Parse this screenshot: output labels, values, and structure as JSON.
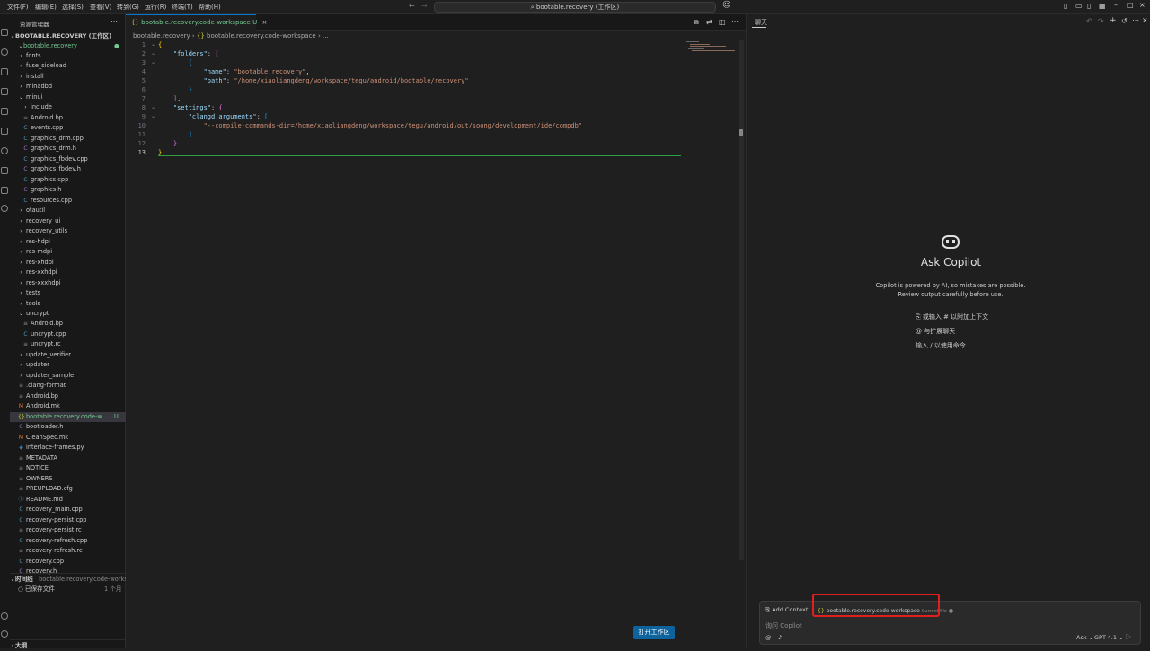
{
  "menu": [
    "文件(F)",
    "编辑(E)",
    "选择(S)",
    "查看(V)",
    "转到(G)",
    "运行(R)",
    "终端(T)",
    "帮助(H)"
  ],
  "search": {
    "text": "bootable.recovery (工作区)"
  },
  "sidebar": {
    "header": "资源管理器",
    "workspace": "BOOTABLE.RECOVERY (工作区)",
    "root": "bootable.recovery",
    "items": [
      {
        "label": "fonts",
        "icon": "folder",
        "indent": 1
      },
      {
        "label": "fuse_sideload",
        "icon": "folder",
        "indent": 1
      },
      {
        "label": "install",
        "icon": "folder",
        "indent": 1
      },
      {
        "label": "minadbd",
        "icon": "folder",
        "indent": 1
      },
      {
        "label": "minui",
        "icon": "folder-open",
        "indent": 1
      },
      {
        "label": "include",
        "icon": "folder",
        "indent": 2
      },
      {
        "label": "Android.bp",
        "icon": "file",
        "indent": 2
      },
      {
        "label": "events.cpp",
        "icon": "cpp",
        "indent": 2
      },
      {
        "label": "graphics_drm.cpp",
        "icon": "cpp",
        "indent": 2
      },
      {
        "label": "graphics_drm.h",
        "icon": "h",
        "indent": 2
      },
      {
        "label": "graphics_fbdev.cpp",
        "icon": "cpp",
        "indent": 2
      },
      {
        "label": "graphics_fbdev.h",
        "icon": "h",
        "indent": 2
      },
      {
        "label": "graphics.cpp",
        "icon": "cpp",
        "indent": 2
      },
      {
        "label": "graphics.h",
        "icon": "h",
        "indent": 2
      },
      {
        "label": "resources.cpp",
        "icon": "cpp",
        "indent": 2
      },
      {
        "label": "otautil",
        "icon": "folder",
        "indent": 1
      },
      {
        "label": "recovery_ui",
        "icon": "folder",
        "indent": 1
      },
      {
        "label": "recovery_utils",
        "icon": "folder",
        "indent": 1
      },
      {
        "label": "res-hdpi",
        "icon": "folder",
        "indent": 1
      },
      {
        "label": "res-mdpi",
        "icon": "folder",
        "indent": 1
      },
      {
        "label": "res-xhdpi",
        "icon": "folder",
        "indent": 1
      },
      {
        "label": "res-xxhdpi",
        "icon": "folder",
        "indent": 1
      },
      {
        "label": "res-xxxhdpi",
        "icon": "folder",
        "indent": 1
      },
      {
        "label": "tests",
        "icon": "folder",
        "indent": 1
      },
      {
        "label": "tools",
        "icon": "folder",
        "indent": 1
      },
      {
        "label": "uncrypt",
        "icon": "folder-open",
        "indent": 1
      },
      {
        "label": "Android.bp",
        "icon": "file",
        "indent": 2
      },
      {
        "label": "uncrypt.cpp",
        "icon": "cpp",
        "indent": 2
      },
      {
        "label": "uncrypt.rc",
        "icon": "file",
        "indent": 2
      },
      {
        "label": "update_verifier",
        "icon": "folder",
        "indent": 1
      },
      {
        "label": "updater",
        "icon": "folder",
        "indent": 1
      },
      {
        "label": "updater_sample",
        "icon": "folder",
        "indent": 1
      },
      {
        "label": ".clang-format",
        "icon": "file",
        "indent": 1
      },
      {
        "label": "Android.bp",
        "icon": "file",
        "indent": 1
      },
      {
        "label": "Android.mk",
        "icon": "mk",
        "indent": 1
      },
      {
        "label": "bootable.recovery.code-w...",
        "icon": "json",
        "indent": 1,
        "selected": true,
        "badge": "U"
      },
      {
        "label": "bootloader.h",
        "icon": "h",
        "indent": 1
      },
      {
        "label": "CleanSpec.mk",
        "icon": "mk",
        "indent": 1
      },
      {
        "label": "interlace-frames.py",
        "icon": "py",
        "indent": 1
      },
      {
        "label": "METADATA",
        "icon": "file",
        "indent": 1
      },
      {
        "label": "NOTICE",
        "icon": "file",
        "indent": 1
      },
      {
        "label": "OWNERS",
        "icon": "file",
        "indent": 1
      },
      {
        "label": "PREUPLOAD.cfg",
        "icon": "file",
        "indent": 1
      },
      {
        "label": "README.md",
        "icon": "info",
        "indent": 1
      },
      {
        "label": "recovery_main.cpp",
        "icon": "cpp",
        "indent": 1
      },
      {
        "label": "recovery-persist.cpp",
        "icon": "cpp",
        "indent": 1
      },
      {
        "label": "recovery-persist.rc",
        "icon": "file",
        "indent": 1
      },
      {
        "label": "recovery-refresh.cpp",
        "icon": "cpp",
        "indent": 1
      },
      {
        "label": "recovery-refresh.rc",
        "icon": "file",
        "indent": 1
      },
      {
        "label": "recovery.cpp",
        "icon": "cpp",
        "indent": 1
      },
      {
        "label": "recovery.h",
        "icon": "h",
        "indent": 1
      }
    ],
    "timeline": {
      "title": "时间线",
      "file": "bootable.recovery.code-workspace",
      "entry": "已保存文件",
      "time": "1 个月"
    },
    "outline": "大纲"
  },
  "editor": {
    "tab": "bootable.recovery.code-workspace",
    "tab_badge": "U",
    "breadcrumb_root": "bootable.recovery",
    "breadcrumb_file": "bootable.recovery.code-workspace",
    "breadcrumb_tail": "...",
    "lines": [
      "1",
      "2",
      "3",
      "4",
      "5",
      "6",
      "7",
      "8",
      "9",
      "10",
      "11",
      "12",
      "13"
    ],
    "open_workspace": "打开工作区"
  },
  "code": {
    "folders": "\"folders\"",
    "name_key": "\"name\"",
    "name_val": "\"bootable.recovery\"",
    "path_key": "\"path\"",
    "path_val": "\"/home/xiaoliangdeng/workspace/tegu/android/bootable/recovery\"",
    "settings": "\"settings\"",
    "clangd": "\"clangd.arguments\"",
    "arg": "\"--compile-commands-dir=/home/xiaoliangdeng/workspace/tegu/android/out/soong/development/ide/compdb\""
  },
  "chat": {
    "header": "聊天",
    "title": "Ask Copilot",
    "desc": "Copilot is powered by AI, so mistakes are possible. Review output carefully before use.",
    "hint1": "或输入 # 以附加上下文",
    "hint2": "与扩展聊天",
    "hint3": "输入 / 以使用命令",
    "add_context": "Add Context...",
    "context_file": "bootable.recovery.code-workspace",
    "context_tag": "Current file",
    "placeholder": "询问 Copilot",
    "mode": "Ask",
    "model": "GPT-4.1"
  },
  "colors": {
    "accent": "#0078d4",
    "untracked": "#73c991",
    "highlight": "#e02020"
  }
}
